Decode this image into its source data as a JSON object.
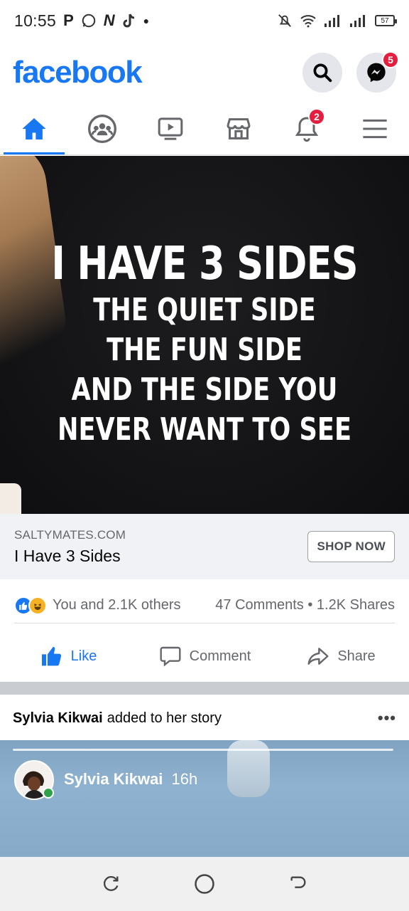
{
  "status_bar": {
    "time": "10:55",
    "glyphs": [
      "P",
      "N"
    ],
    "battery": "57"
  },
  "header": {
    "logo": "facebook",
    "messenger_badge": "5"
  },
  "tabs": [
    {
      "name": "home",
      "active": true
    },
    {
      "name": "groups",
      "active": false
    },
    {
      "name": "watch",
      "active": false
    },
    {
      "name": "marketplace",
      "active": false
    },
    {
      "name": "notifications",
      "active": false,
      "badge": "2"
    },
    {
      "name": "menu",
      "active": false
    }
  ],
  "ad": {
    "shirt_title": "I HAVE 3 SIDES",
    "shirt_lines": [
      "THE QUIET SIDE",
      "THE FUN SIDE",
      "AND THE SIDE YOU",
      "NEVER WANT TO SEE"
    ],
    "domain": "SALTYMATES.COM",
    "title": "I Have 3 Sides",
    "cta": "SHOP NOW"
  },
  "reactions": {
    "summary": "You and 2.1K others",
    "comments": "47 Comments",
    "shares": "1.2K Shares"
  },
  "actions": {
    "like": "Like",
    "comment": "Comment",
    "share": "Share"
  },
  "story": {
    "author": "Sylvia Kikwai",
    "action_text": "added to her story",
    "more": "•••",
    "time": "16h"
  },
  "colors": {
    "brand": "#1877f2",
    "badge": "#e41e3f"
  }
}
